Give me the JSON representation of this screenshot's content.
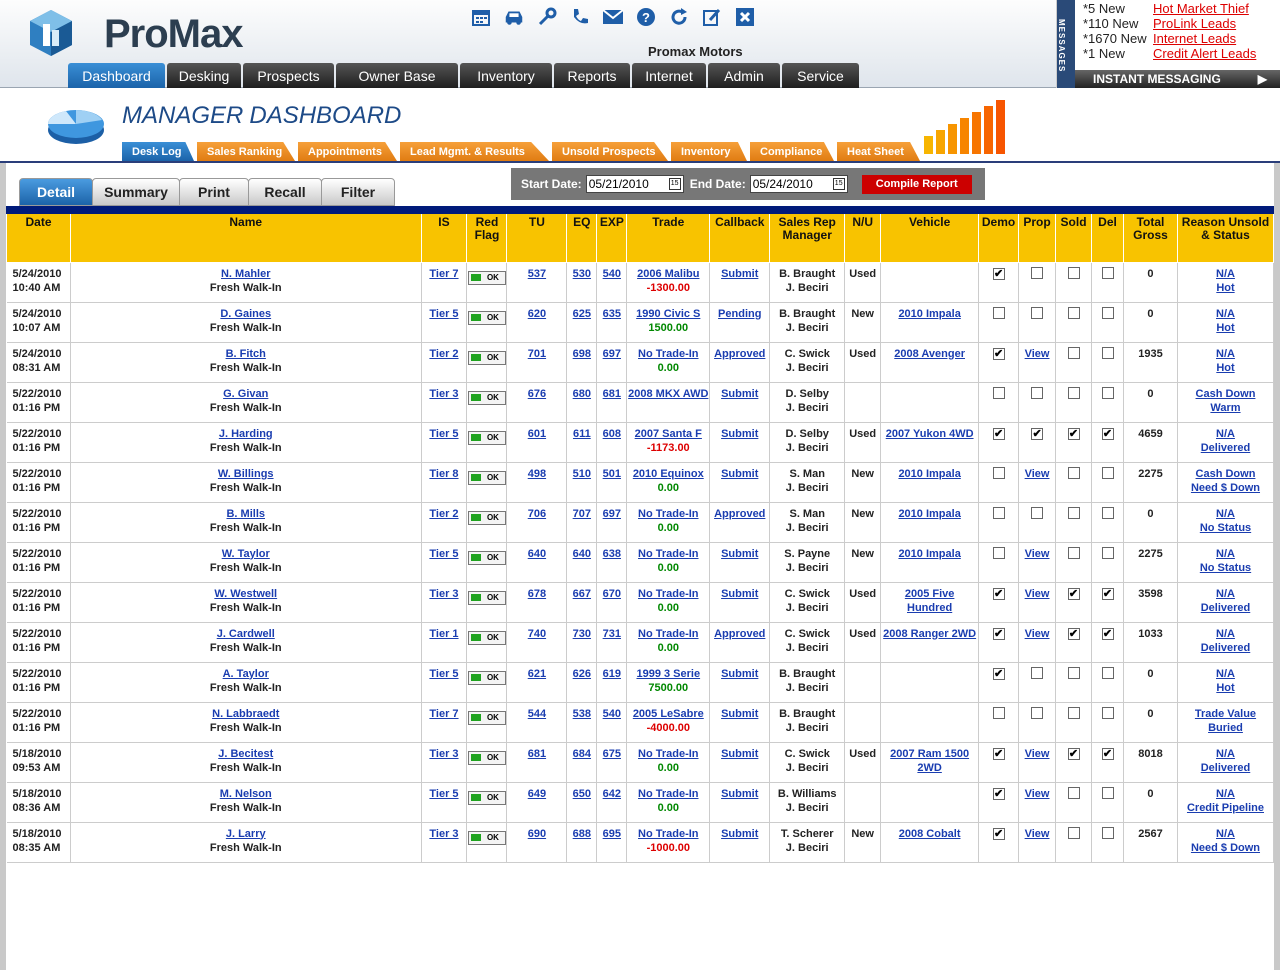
{
  "app": {
    "dealer": "Promax Motors",
    "logo_text": "ProMax"
  },
  "toolbar_icons": [
    "calendar-icon",
    "car-icon",
    "wrench-icon",
    "phone-icon",
    "mail-icon",
    "help-icon",
    "refresh-icon",
    "edit-icon",
    "close-icon"
  ],
  "nav": {
    "tabs": [
      "Dashboard",
      "Desking",
      "Prospects",
      "Owner Base",
      "Inventory",
      "Reports",
      "Internet",
      "Admin",
      "Service"
    ],
    "active": "Dashboard"
  },
  "messages": {
    "bar_label": "MESSAGES",
    "items": [
      {
        "count": "*5 New",
        "label": "Hot Market Thief"
      },
      {
        "count": "*110 New",
        "label": "ProLink Leads"
      },
      {
        "count": "*1670 New",
        "label": "Internet Leads"
      },
      {
        "count": "*1 New",
        "label": "Credit Alert Leads"
      }
    ],
    "instant_messaging": "INSTANT MESSAGING"
  },
  "manager": {
    "title_bold": "MANAGER",
    "title_light": "DASHBOARD",
    "subtabs": [
      "Desk Log",
      "Sales Ranking",
      "Appointments",
      "Lead Mgmt. & Results",
      "Unsold Prospects",
      "Inventory",
      "Compliance",
      "Heat Sheet"
    ],
    "active_subtab": "Desk Log"
  },
  "views": {
    "tabs": [
      "Detail",
      "Summary",
      "Print",
      "Recall",
      "Filter"
    ],
    "active": "Detail"
  },
  "dates": {
    "start_label": "Start Date:",
    "start_value": "05/21/2010",
    "end_label": "End Date:",
    "end_value": "05/24/2010",
    "compile_label": "Compile Report"
  },
  "colors": {
    "header": "#f8c300",
    "nav_active": "#1f6fbf",
    "subtab": "#f08c1e",
    "compile": "#cc0000",
    "negative": "#dd0000",
    "positive": "#008800"
  },
  "columns": [
    "Date",
    "Name",
    "IS",
    "Red Flag",
    "TU",
    "EQ",
    "EXP",
    "Trade",
    "Callback",
    "Sales Rep Manager",
    "N/U",
    "Vehicle",
    "Demo",
    "Prop",
    "Sold",
    "Del",
    "Total Gross",
    "Reason Unsold & Status"
  ],
  "rows": [
    {
      "date": "5/24/2010",
      "time": "10:40 AM",
      "name": "N. Mahler",
      "source": "Fresh Walk-In",
      "tier": "Tier 7",
      "flag": "OK",
      "tu": "537",
      "eq": "530",
      "exp": "540",
      "trade": "2006 Malibu",
      "trade_amt": "-1300.00",
      "callback": "Submit",
      "rep": "B. Braught",
      "mgr": "J. Beciri",
      "nu": "Used",
      "vehicle": "",
      "demo": true,
      "prop": false,
      "prop_view": false,
      "sold": false,
      "del": false,
      "gross": "0",
      "reason": "N/A",
      "status": "Hot"
    },
    {
      "date": "5/24/2010",
      "time": "10:07 AM",
      "name": "D. Gaines",
      "source": "Fresh Walk-In",
      "tier": "Tier 5",
      "flag": "OK",
      "tu": "620",
      "eq": "625",
      "exp": "635",
      "trade": "1990 Civic S",
      "trade_amt": "1500.00",
      "callback": "Pending",
      "rep": "B. Braught",
      "mgr": "J. Beciri",
      "nu": "New",
      "vehicle": "2010 Impala",
      "demo": false,
      "prop": false,
      "prop_view": false,
      "sold": false,
      "del": false,
      "gross": "0",
      "reason": "N/A",
      "status": "Hot"
    },
    {
      "date": "5/24/2010",
      "time": "08:31 AM",
      "name": "B. Fitch",
      "source": "Fresh Walk-In",
      "tier": "Tier 2",
      "flag": "OK",
      "tu": "701",
      "eq": "698",
      "exp": "697",
      "trade": "No Trade-In",
      "trade_amt": "0.00",
      "callback": "Approved",
      "rep": "C. Swick",
      "mgr": "J. Beciri",
      "nu": "Used",
      "vehicle": "2008 Avenger",
      "demo": true,
      "prop": false,
      "prop_view": true,
      "sold": false,
      "del": false,
      "gross": "1935",
      "reason": "N/A",
      "status": "Hot"
    },
    {
      "date": "5/22/2010",
      "time": "01:16 PM",
      "name": "G. Givan",
      "source": "Fresh Walk-In",
      "tier": "Tier 3",
      "flag": "OK",
      "tu": "676",
      "eq": "680",
      "exp": "681",
      "trade": "2008 MKX AWD",
      "trade_amt": "",
      "callback": "Submit",
      "rep": "D. Selby",
      "mgr": "J. Beciri",
      "nu": "",
      "vehicle": "",
      "demo": false,
      "prop": false,
      "prop_view": false,
      "sold": false,
      "del": false,
      "gross": "0",
      "reason": "Cash Down",
      "status": "Warm"
    },
    {
      "date": "5/22/2010",
      "time": "01:16 PM",
      "name": "J. Harding",
      "source": "Fresh Walk-In",
      "tier": "Tier 5",
      "flag": "OK",
      "tu": "601",
      "eq": "611",
      "exp": "608",
      "trade": "2007 Santa F",
      "trade_amt": "-1173.00",
      "callback": "Submit",
      "rep": "D. Selby",
      "mgr": "J. Beciri",
      "nu": "Used",
      "vehicle": "2007 Yukon 4WD",
      "demo": true,
      "prop": true,
      "prop_view": false,
      "sold": true,
      "del": true,
      "gross": "4659",
      "reason": "N/A",
      "status": "Delivered"
    },
    {
      "date": "5/22/2010",
      "time": "01:16 PM",
      "name": "W. Billings",
      "source": "Fresh Walk-In",
      "tier": "Tier 8",
      "flag": "OK",
      "tu": "498",
      "eq": "510",
      "exp": "501",
      "trade": "2010 Equinox",
      "trade_amt": "0.00",
      "callback": "Submit",
      "rep": "S. Man",
      "mgr": "J. Beciri",
      "nu": "New",
      "vehicle": "2010 Impala",
      "demo": false,
      "prop": false,
      "prop_view": true,
      "sold": false,
      "del": false,
      "gross": "2275",
      "reason": "Cash Down",
      "status": "Need $ Down"
    },
    {
      "date": "5/22/2010",
      "time": "01:16 PM",
      "name": "B. Mills",
      "source": "Fresh Walk-In",
      "tier": "Tier 2",
      "flag": "OK",
      "tu": "706",
      "eq": "707",
      "exp": "697",
      "trade": "No Trade-In",
      "trade_amt": "0.00",
      "callback": "Approved",
      "rep": "S. Man",
      "mgr": "J. Beciri",
      "nu": "New",
      "vehicle": "2010 Impala",
      "demo": false,
      "prop": false,
      "prop_view": false,
      "sold": false,
      "del": false,
      "gross": "0",
      "reason": "N/A",
      "status": "No Status"
    },
    {
      "date": "5/22/2010",
      "time": "01:16 PM",
      "name": "W. Taylor",
      "source": "Fresh Walk-In",
      "tier": "Tier 5",
      "flag": "OK",
      "tu": "640",
      "eq": "640",
      "exp": "638",
      "trade": "No Trade-In",
      "trade_amt": "0.00",
      "callback": "Submit",
      "rep": "S. Payne",
      "mgr": "J. Beciri",
      "nu": "New",
      "vehicle": "2010 Impala",
      "demo": false,
      "prop": false,
      "prop_view": true,
      "sold": false,
      "del": false,
      "gross": "2275",
      "reason": "N/A",
      "status": "No Status"
    },
    {
      "date": "5/22/2010",
      "time": "01:16 PM",
      "name": "W. Westwell",
      "source": "Fresh Walk-In",
      "tier": "Tier 3",
      "flag": "OK",
      "tu": "678",
      "eq": "667",
      "exp": "670",
      "trade": "No Trade-In",
      "trade_amt": "0.00",
      "callback": "Submit",
      "rep": "C. Swick",
      "mgr": "J. Beciri",
      "nu": "Used",
      "vehicle": "2005 Five Hundred",
      "demo": true,
      "prop": false,
      "prop_view": true,
      "sold": true,
      "del": true,
      "gross": "3598",
      "reason": "N/A",
      "status": "Delivered"
    },
    {
      "date": "5/22/2010",
      "time": "01:16 PM",
      "name": "J. Cardwell",
      "source": "Fresh Walk-In",
      "tier": "Tier 1",
      "flag": "OK",
      "tu": "740",
      "eq": "730",
      "exp": "731",
      "trade": "No Trade-In",
      "trade_amt": "0.00",
      "callback": "Approved",
      "rep": "C. Swick",
      "mgr": "J. Beciri",
      "nu": "Used",
      "vehicle": "2008 Ranger 2WD",
      "demo": true,
      "prop": false,
      "prop_view": true,
      "sold": true,
      "del": true,
      "gross": "1033",
      "reason": "N/A",
      "status": "Delivered"
    },
    {
      "date": "5/22/2010",
      "time": "01:16 PM",
      "name": "A. Taylor",
      "source": "Fresh Walk-In",
      "tier": "Tier 5",
      "flag": "OK",
      "tu": "621",
      "eq": "626",
      "exp": "619",
      "trade": "1999 3 Serie",
      "trade_amt": "7500.00",
      "callback": "Submit",
      "rep": "B. Braught",
      "mgr": "J. Beciri",
      "nu": "",
      "vehicle": "",
      "demo": true,
      "prop": false,
      "prop_view": false,
      "sold": false,
      "del": false,
      "gross": "0",
      "reason": "N/A",
      "status": "Hot"
    },
    {
      "date": "5/22/2010",
      "time": "01:16 PM",
      "name": "N. Labbraedt",
      "source": "Fresh Walk-In",
      "tier": "Tier 7",
      "flag": "OK",
      "tu": "544",
      "eq": "538",
      "exp": "540",
      "trade": "2005 LeSabre",
      "trade_amt": "-4000.00",
      "callback": "Submit",
      "rep": "B. Braught",
      "mgr": "J. Beciri",
      "nu": "",
      "vehicle": "",
      "demo": false,
      "prop": false,
      "prop_view": false,
      "sold": false,
      "del": false,
      "gross": "0",
      "reason": "Trade Value",
      "status": "Buried"
    },
    {
      "date": "5/18/2010",
      "time": "09:53 AM",
      "name": "J. Becitest",
      "source": "Fresh Walk-In",
      "tier": "Tier 3",
      "flag": "OK",
      "tu": "681",
      "eq": "684",
      "exp": "675",
      "trade": "No Trade-In",
      "trade_amt": "0.00",
      "callback": "Submit",
      "rep": "C. Swick",
      "mgr": "J. Beciri",
      "nu": "Used",
      "vehicle": "2007 Ram 1500 2WD",
      "demo": true,
      "prop": false,
      "prop_view": true,
      "sold": true,
      "del": true,
      "gross": "8018",
      "reason": "N/A",
      "status": "Delivered"
    },
    {
      "date": "5/18/2010",
      "time": "08:36 AM",
      "name": "M. Nelson",
      "source": "Fresh Walk-In",
      "tier": "Tier 5",
      "flag": "OK",
      "tu": "649",
      "eq": "650",
      "exp": "642",
      "trade": "No Trade-In",
      "trade_amt": "0.00",
      "callback": "Submit",
      "rep": "B. Williams",
      "mgr": "J. Beciri",
      "nu": "",
      "vehicle": "",
      "demo": true,
      "prop": false,
      "prop_view": true,
      "sold": false,
      "del": false,
      "gross": "0",
      "reason": "N/A",
      "status": "Credit Pipeline"
    },
    {
      "date": "5/18/2010",
      "time": "08:35 AM",
      "name": "J. Larry",
      "source": "Fresh Walk-In",
      "tier": "Tier 3",
      "flag": "OK",
      "tu": "690",
      "eq": "688",
      "exp": "695",
      "trade": "No Trade-In",
      "trade_amt": "-1000.00",
      "callback": "Submit",
      "rep": "T. Scherer",
      "mgr": "J. Beciri",
      "nu": "New",
      "vehicle": "2008 Cobalt",
      "demo": true,
      "prop": false,
      "prop_view": true,
      "sold": false,
      "del": false,
      "gross": "2567",
      "reason": "N/A",
      "status": "Need $ Down"
    }
  ],
  "prop_view_label": "View"
}
